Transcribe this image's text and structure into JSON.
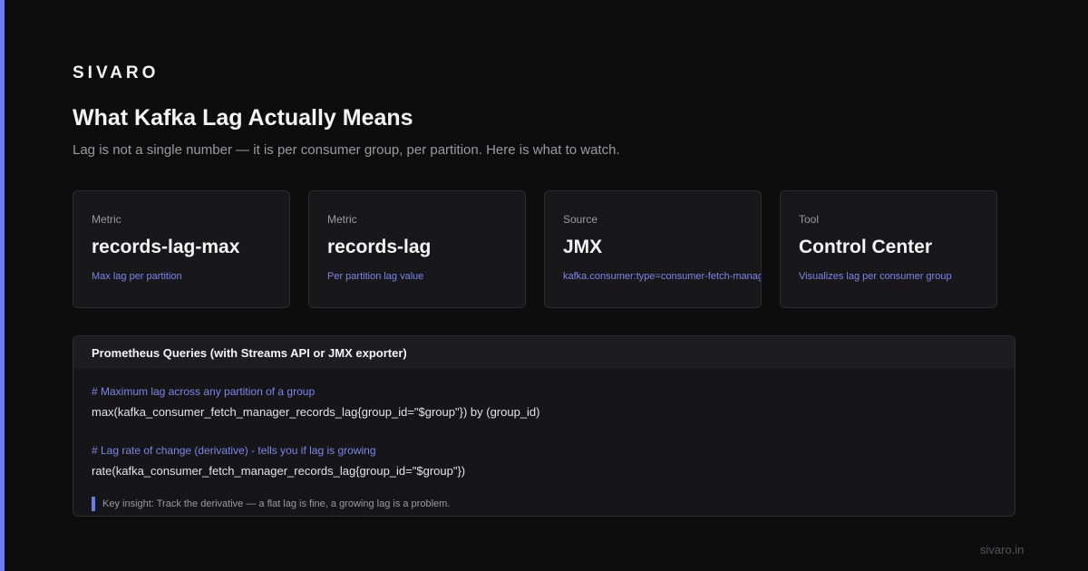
{
  "brand": "SIVARO",
  "title": "What Kafka Lag Actually Means",
  "subtitle": "Lag is not a single number — it is per consumer group, per partition. Here is what to watch.",
  "cards": [
    {
      "label": "Metric",
      "value": "records-lag-max",
      "desc": "Max lag per partition"
    },
    {
      "label": "Metric",
      "value": "records-lag",
      "desc": "Per partition lag value"
    },
    {
      "label": "Source",
      "value": "JMX",
      "desc": "kafka.consumer:type=consumer-fetch-manager-metrics"
    },
    {
      "label": "Tool",
      "value": "Control Center",
      "desc": "Visualizes lag per consumer group"
    }
  ],
  "queries": {
    "heading": "Prometheus Queries (with Streams API or JMX exporter)",
    "items": [
      {
        "comment": "# Maximum lag across any partition of a group",
        "code": "max(kafka_consumer_fetch_manager_records_lag{group_id=\"$group\"}) by (group_id)"
      },
      {
        "comment": "# Lag rate of change (derivative) - tells you if lag is growing",
        "code": "rate(kafka_consumer_fetch_manager_records_lag{group_id=\"$group\"})"
      }
    ],
    "insight": "Key insight: Track the derivative — a flat lag is fine, a growing lag is a problem."
  },
  "footer": "sivaro.in",
  "colors": {
    "accent": "#6d7cf0",
    "background": "#0d0d0e",
    "card": "#18181b"
  }
}
